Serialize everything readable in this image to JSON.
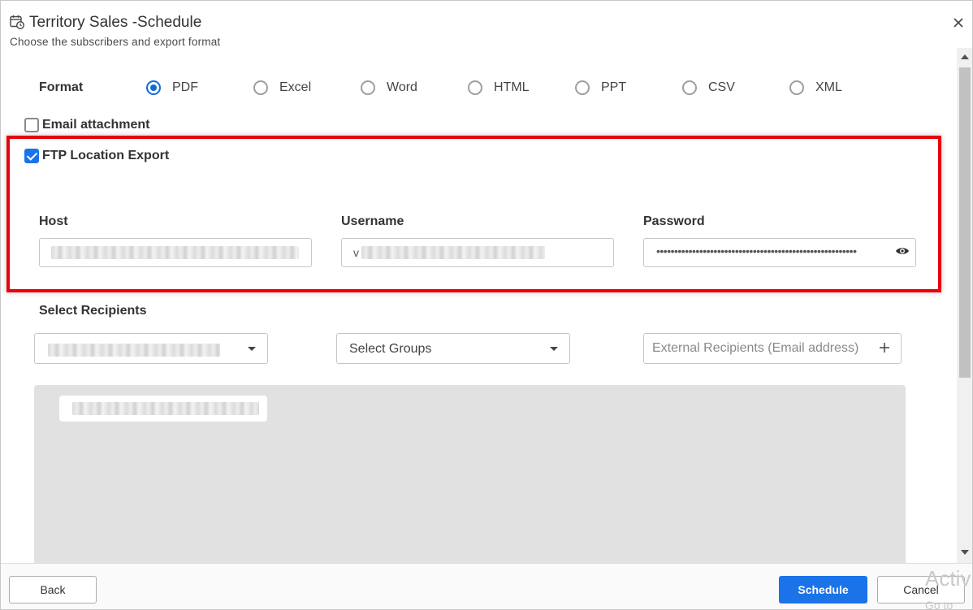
{
  "header": {
    "title": "Territory Sales -Schedule",
    "subtitle": "Choose the subscribers and export format"
  },
  "format": {
    "label": "Format",
    "selected": "PDF",
    "options": [
      "PDF",
      "Excel",
      "Word",
      "HTML",
      "PPT",
      "CSV",
      "XML"
    ]
  },
  "email_attachment": {
    "label": "Email attachment",
    "checked": false
  },
  "ftp": {
    "label": "FTP Location Export",
    "checked": true,
    "host_label": "Host",
    "username_label": "Username",
    "password_label": "Password",
    "username_value_prefix": "v",
    "password_mask": "••••••••••••••••••••••••••••••••••••••••••••••••••••••••"
  },
  "recipients": {
    "label": "Select Recipients",
    "groups_placeholder": "Select Groups",
    "external_placeholder": "External Recipients (Email address)"
  },
  "footer": {
    "back_label": "Back",
    "schedule_label": "Schedule",
    "cancel_label": "Cancel",
    "watermark_text": "Activ",
    "watermark_subtext": "Go to"
  },
  "colors": {
    "accent": "#1a73e8",
    "highlight": "#e8000b"
  }
}
